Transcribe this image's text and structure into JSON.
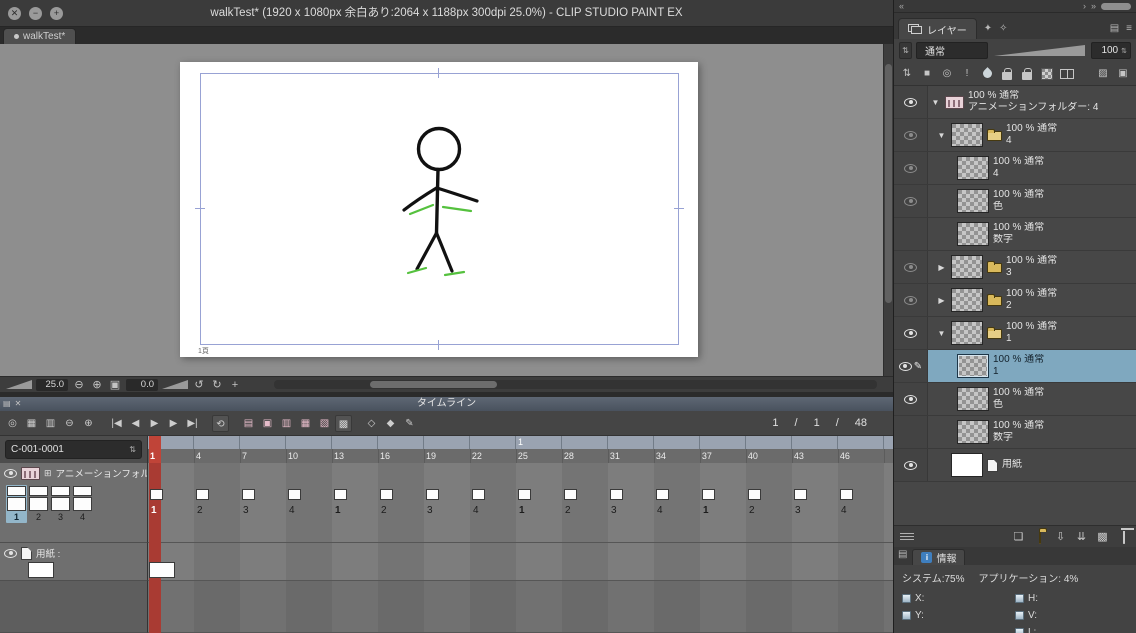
{
  "window": {
    "title": "walkTest* (1920 x 1080px 余白あり:2064 x 1188px 300dpi 25.0%)  - CLIP STUDIO PAINT EX",
    "tab_label": "walkTest*"
  },
  "canvas": {
    "page_label": "1頁",
    "zoom_value": "25.0",
    "rotation_value": "0.0"
  },
  "timeline": {
    "panel_title": "タイムライン",
    "clip_name": "C-001-0001",
    "counter": {
      "current": "1",
      "sep": "/",
      "start": "1",
      "end": "48"
    },
    "ruler_seconds_label": "1",
    "ruler_frames": [
      "1",
      "4",
      "7",
      "10",
      "13",
      "16",
      "19",
      "22",
      "25",
      "28",
      "31",
      "34",
      "37",
      "40",
      "43",
      "46"
    ],
    "tracks": {
      "animation": {
        "label": "アニメーションフォル",
        "thumb_numbers": [
          "1",
          "2",
          "3",
          "4"
        ],
        "cels": [
          "1",
          "2",
          "3",
          "4",
          "1",
          "2",
          "3",
          "4",
          "1",
          "2",
          "3",
          "4",
          "1",
          "2",
          "3",
          "4"
        ]
      },
      "paper": {
        "label": "用紙 :"
      }
    }
  },
  "layer_panel": {
    "tab_label": "レイヤー",
    "blend_mode": "通常",
    "opacity": "100",
    "layers": [
      {
        "line1": "100 % 通常",
        "line2": "アニメーションフォルダー: 4",
        "type": "animation-folder",
        "eye": "on",
        "expand": "open",
        "indent": 0,
        "selected": false
      },
      {
        "line1": "100 % 通常",
        "line2": "4",
        "type": "folder-open",
        "eye": "dim",
        "expand": "open",
        "indent": 1,
        "selected": false
      },
      {
        "line1": "100 % 通常",
        "line2": "4",
        "type": "layer",
        "eye": "dim",
        "indent": 2,
        "selected": false
      },
      {
        "line1": "100 % 通常",
        "line2": "色",
        "type": "layer",
        "eye": "dim",
        "indent": 2,
        "selected": false
      },
      {
        "line1": "100 % 通常",
        "line2": "数字",
        "type": "layer",
        "eye": "off",
        "indent": 2,
        "selected": false
      },
      {
        "line1": "100 % 通常",
        "line2": "3",
        "type": "folder-closed",
        "eye": "dim",
        "expand": "closed",
        "indent": 1,
        "selected": false
      },
      {
        "line1": "100 % 通常",
        "line2": "2",
        "type": "folder-closed",
        "eye": "dim",
        "expand": "closed",
        "indent": 1,
        "selected": false
      },
      {
        "line1": "100 % 通常",
        "line2": "1",
        "type": "folder-open",
        "eye": "on",
        "expand": "open",
        "indent": 1,
        "selected": false
      },
      {
        "line1": "100 % 通常",
        "line2": "1",
        "type": "layer",
        "eye": "on",
        "pen": true,
        "indent": 2,
        "selected": true
      },
      {
        "line1": "100 % 通常",
        "line2": "色",
        "type": "layer",
        "eye": "on",
        "indent": 2,
        "selected": false
      },
      {
        "line1": "100 % 通常",
        "line2": "数字",
        "type": "layer",
        "eye": "off",
        "indent": 2,
        "selected": false
      },
      {
        "line1": "用紙",
        "line2": "",
        "type": "paper-layer",
        "eye": "on",
        "indent": 1,
        "selected": false
      }
    ]
  },
  "info_panel": {
    "tab_label": "情報",
    "system_label": "システム:75%",
    "app_label": "アプリケーション: 4%",
    "fields_left": [
      "X:",
      "Y:"
    ],
    "fields_right": [
      "H:",
      "V:",
      "L:"
    ]
  },
  "icons": {
    "close_window": "✕",
    "minimize_window": "−",
    "zoom_window": "+",
    "zoom_out": "⊖",
    "zoom_in": "⊕",
    "fit_view": "▣",
    "rotate_ccw": "↺",
    "rotate_cw": "↻",
    "reset_view": "+",
    "panel_menu": "▤",
    "panel_close": "✕",
    "timeline_options": "◎",
    "track_list": "▦",
    "track_list_alt": "▥",
    "go_first": "|◀",
    "prev_frame": "◀",
    "play": "▶",
    "next_frame": "▶",
    "go_last": "▶|",
    "loop": "⟲",
    "new_animation_folder": "▤",
    "new_cel": "▣",
    "specify_cel": "▥",
    "batch_cel": "▦",
    "cel_settings": "▧",
    "onion_skin": "▩",
    "keyframe_off": "◇",
    "keyframe_on": "◆",
    "pen": "✎",
    "track_expand": "⊞",
    "stepper": "⇅",
    "collapse_dock": "«",
    "dock_arrow": "›",
    "dock_arrow_double": "»",
    "palette_star": "✦",
    "palette_star_alt": "✧",
    "tab_list": "▤",
    "tab_menu": "≡",
    "ring": "◎",
    "fill_square": "■",
    "pin": "!",
    "ruler": "▨",
    "mask_square": "▣",
    "new_layer": "❏",
    "transfer_down": "⇩",
    "merge_down": "⇊",
    "mask": "▩",
    "expand_open": "▼",
    "expand_closed": "▶"
  },
  "colors": {
    "selection_accent": "#7fa8bf",
    "playhead_red": "#a93b33",
    "canvas_guide_blue": "#98a2d4",
    "timeline_header": "#515a66",
    "pink_icon": "#e6bcca"
  }
}
